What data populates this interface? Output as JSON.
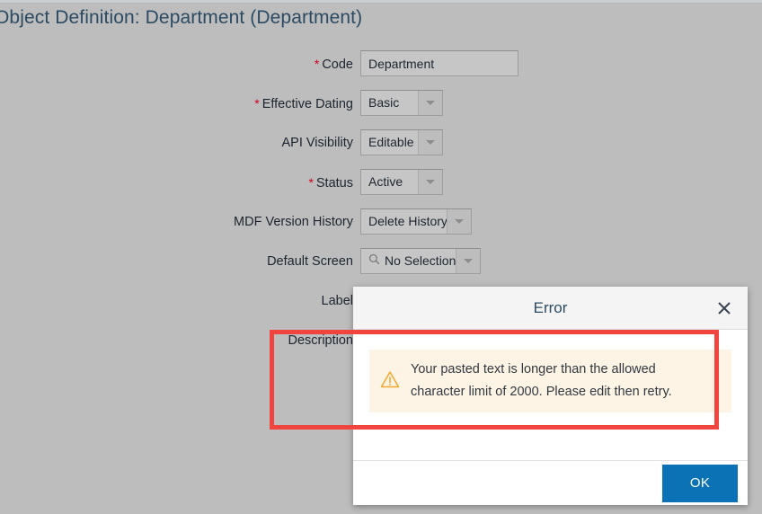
{
  "page": {
    "title": "Object Definition: Department (Department)"
  },
  "form": {
    "fields": [
      {
        "label": "Code",
        "required": true,
        "type": "text",
        "value": "Department"
      },
      {
        "label": "Effective Dating",
        "required": true,
        "type": "select",
        "value": "Basic"
      },
      {
        "label": "API Visibility",
        "required": false,
        "type": "select",
        "value": "Editable"
      },
      {
        "label": "Status",
        "required": true,
        "type": "select",
        "value": "Active"
      },
      {
        "label": "MDF Version History",
        "required": false,
        "type": "select",
        "value": "Delete History"
      },
      {
        "label": "Default Screen",
        "required": false,
        "type": "search-select",
        "value": "No Selection"
      },
      {
        "label": "Label",
        "required": false,
        "type": "hidden",
        "value": ""
      },
      {
        "label": "Description",
        "required": false,
        "type": "hidden",
        "value": ""
      }
    ],
    "required_marker": "*"
  },
  "dialog": {
    "title": "Error",
    "close_icon": "close-icon",
    "warning_icon": "warning-triangle-icon",
    "message": "Your pasted text is longer than the allowed character limit of 2000. Please edit then retry.",
    "ok_label": "OK"
  },
  "annotation": {
    "highlight_color": "#f0453f"
  },
  "colors": {
    "background": "#bdbdbd",
    "title_text": "#2b4a63",
    "required_star": "#d0021b",
    "primary_button": "#0a72b5",
    "message_background": "#fdf4e6",
    "warning_icon": "#f0a830"
  }
}
